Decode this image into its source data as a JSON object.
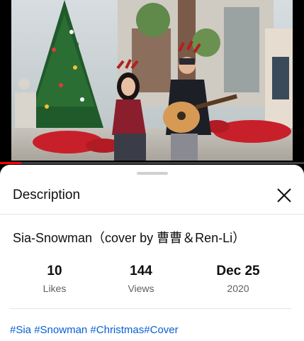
{
  "video": {
    "progress_fraction": 0.07,
    "progress_color": "#ff0000"
  },
  "sheet": {
    "title": "Description",
    "close_icon": "close-icon",
    "video_title": "Sia-Snowman（cover by 曹曹＆Ren-Li）",
    "stats": [
      {
        "value": "10",
        "label": "Likes"
      },
      {
        "value": "144",
        "label": "Views"
      },
      {
        "value": "Dec 25",
        "label": "2020"
      }
    ],
    "tags": [
      "#Sia",
      "#Snowman",
      "#Christmas",
      "#Cover"
    ],
    "link_color": "#065fd4"
  }
}
